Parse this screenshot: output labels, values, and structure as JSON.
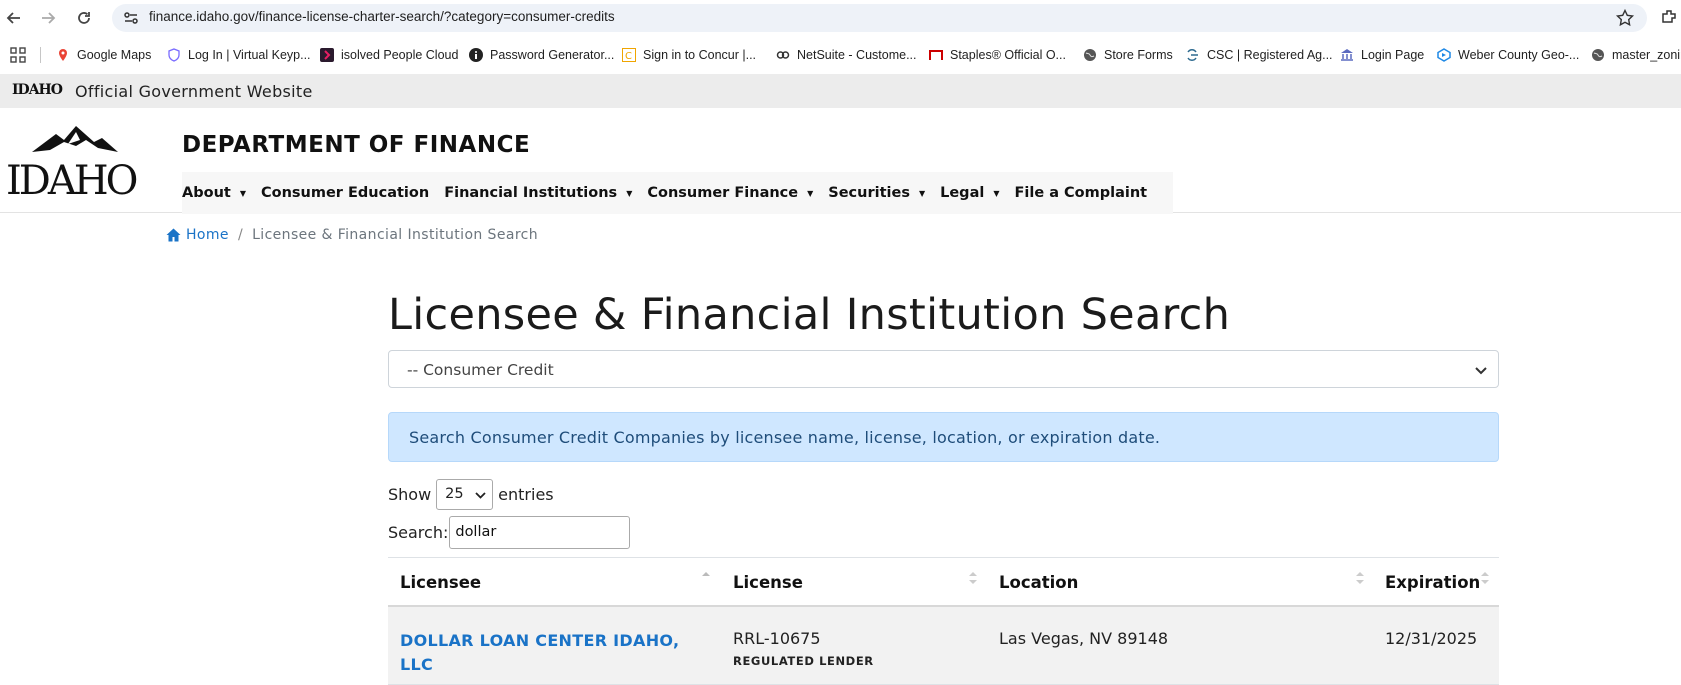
{
  "browser": {
    "url": "finance.idaho.gov/finance-license-charter-search/?category=consumer-credits",
    "bookmarks": [
      {
        "label": "Google Maps",
        "icon": "map-pin-icon"
      },
      {
        "label": "Log In | Virtual Keyp...",
        "icon": "shield-icon"
      },
      {
        "label": "isolved People Cloud",
        "icon": "isolved-icon"
      },
      {
        "label": "Password Generator...",
        "icon": "info-icon"
      },
      {
        "label": "Sign in to Concur |...",
        "icon": "concur-icon"
      },
      {
        "label": "NetSuite - Custome...",
        "icon": "netsuite-icon"
      },
      {
        "label": "Staples® Official O...",
        "icon": "staples-icon"
      },
      {
        "label": "Store Forms",
        "icon": "globe-icon"
      },
      {
        "label": "CSC | Registered Ag...",
        "icon": "csc-icon"
      },
      {
        "label": "Login Page",
        "icon": "bank-icon"
      },
      {
        "label": "Weber County Geo-...",
        "icon": "geo-icon"
      },
      {
        "label": "master_zonin",
        "icon": "globe-icon"
      }
    ]
  },
  "gov_banner": {
    "logo": "IDAHO",
    "text": "Official Government Website"
  },
  "header": {
    "logo": "IDAHO",
    "title": "DEPARTMENT OF FINANCE",
    "nav": [
      {
        "label": "About",
        "dropdown": true
      },
      {
        "label": "Consumer Education",
        "dropdown": false
      },
      {
        "label": "Financial Institutions",
        "dropdown": true
      },
      {
        "label": "Consumer Finance",
        "dropdown": true
      },
      {
        "label": "Securities",
        "dropdown": true
      },
      {
        "label": "Legal",
        "dropdown": true
      },
      {
        "label": "File a Complaint",
        "dropdown": false
      }
    ]
  },
  "breadcrumb": {
    "home": "Home",
    "separator": "/",
    "current": "Licensee & Financial Institution Search"
  },
  "main": {
    "title": "Licensee & Financial Institution Search",
    "category_select": "-- Consumer Credit",
    "info": "Search Consumer Credit Companies by licensee name, license, location, or expiration date.",
    "show_label": "Show",
    "entries_value": "25",
    "entries_label": "entries",
    "search_label": "Search:",
    "search_value": "dollar"
  },
  "table": {
    "headers": [
      "Licensee",
      "License",
      "Location",
      "Expiration"
    ],
    "rows": [
      {
        "licensee": "DOLLAR LOAN CENTER IDAHO, LLC",
        "license": "RRL-10675",
        "license_type": "REGULATED LENDER",
        "location": "Las Vegas, NV 89148",
        "expiration": "12/31/2025"
      }
    ]
  },
  "colors": {
    "link": "#1a73c7",
    "info_bg": "#cfe7ff",
    "gov_bar": "#ececec"
  }
}
